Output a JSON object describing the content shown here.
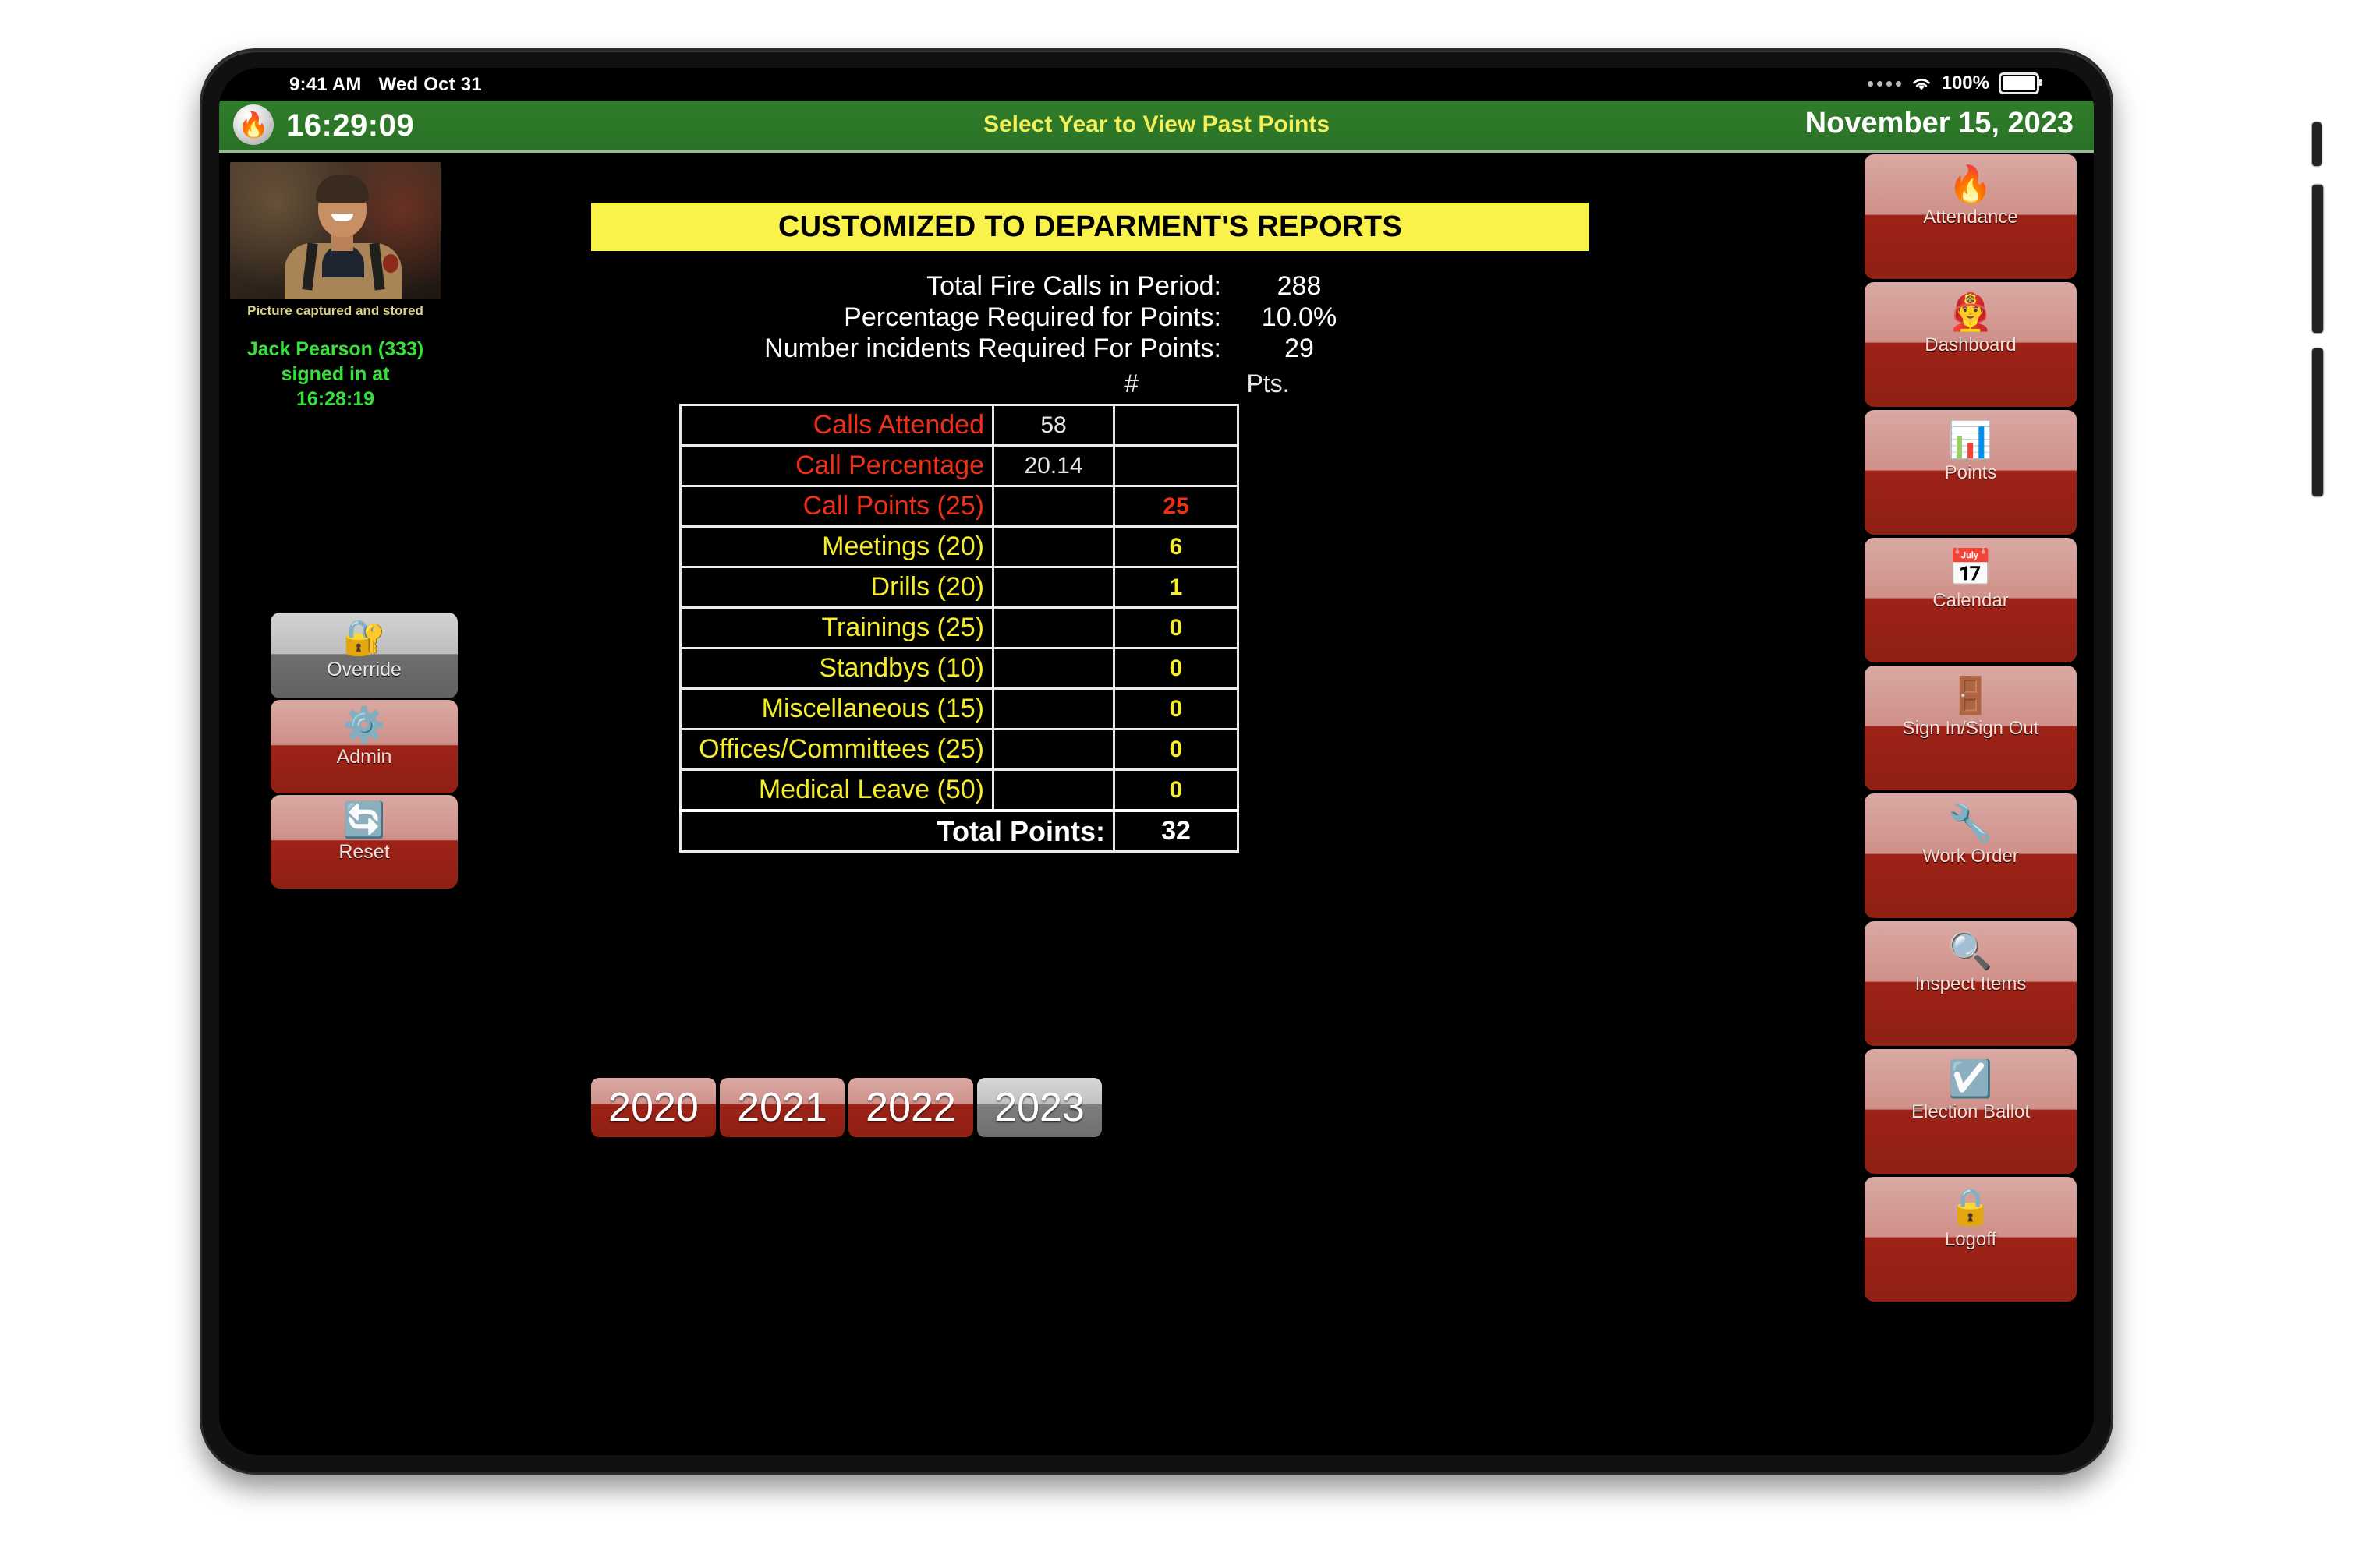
{
  "status_bar": {
    "time": "9:41 AM",
    "date": "Wed Oct 31",
    "battery_pct": "100%",
    "wifi_icon": "wifi-icon",
    "battery_icon": "battery-icon"
  },
  "app_bar": {
    "logo_icon": "flame-logo-icon",
    "clock": "16:29:09",
    "center_message": "Select Year to View Past Points",
    "date": "November 15, 2023"
  },
  "left_panel": {
    "photo_caption": "Picture captured and stored",
    "signed_in_line1": "Jack Pearson (333)",
    "signed_in_line2": "signed in at",
    "signed_in_line3": "16:28:19",
    "buttons": [
      {
        "label": "Override",
        "icon": "lock-key-icon",
        "selected": true
      },
      {
        "label": "Admin",
        "icon": "gear-icon",
        "selected": false
      },
      {
        "label": "Reset",
        "icon": "refresh-arrow-icon",
        "selected": false
      }
    ]
  },
  "right_panel": {
    "buttons": [
      {
        "label": "Attendance",
        "icon": "flame-icon"
      },
      {
        "label": "Dashboard",
        "icon": "firefighter-icon"
      },
      {
        "label": "Points",
        "icon": "report-document-icon"
      },
      {
        "label": "Calendar",
        "icon": "calendar-clock-icon"
      },
      {
        "label": "Sign In/Sign Out",
        "icon": "door-traffic-light-icon"
      },
      {
        "label": "Work Order",
        "icon": "wrench-document-icon"
      },
      {
        "label": "Inspect Items",
        "icon": "magnifier-icon"
      },
      {
        "label": "Election Ballot",
        "icon": "checkmark-box-icon"
      },
      {
        "label": "Logoff",
        "icon": "padlock-icon"
      }
    ]
  },
  "report": {
    "banner_title": "CUSTOMIZED TO DEPARMENT'S REPORTS",
    "summary": [
      {
        "label": "Total Fire Calls in Period:",
        "value": "288"
      },
      {
        "label": "Percentage Required for Points:",
        "value": "10.0%"
      },
      {
        "label": "Number incidents Required For Points:",
        "value": "29"
      }
    ],
    "columns": {
      "count": "#",
      "points": "Pts."
    },
    "rows": [
      {
        "label": "Calls Attended",
        "num": "58",
        "pts": "",
        "color": "red"
      },
      {
        "label": "Call Percentage",
        "num": "20.14",
        "pts": "",
        "color": "red"
      },
      {
        "label": "Call Points (25)",
        "num": "",
        "pts": "25",
        "color": "red"
      },
      {
        "label": "Meetings (20)",
        "num": "",
        "pts": "6",
        "color": "yel"
      },
      {
        "label": "Drills (20)",
        "num": "",
        "pts": "1",
        "color": "yel"
      },
      {
        "label": "Trainings (25)",
        "num": "",
        "pts": "0",
        "color": "yel"
      },
      {
        "label": "Standbys (10)",
        "num": "",
        "pts": "0",
        "color": "yel"
      },
      {
        "label": "Miscellaneous (15)",
        "num": "",
        "pts": "0",
        "color": "yel"
      },
      {
        "label": "Offices/Committees (25)",
        "num": "",
        "pts": "0",
        "color": "yel"
      },
      {
        "label": "Medical Leave (50)",
        "num": "",
        "pts": "0",
        "color": "yel"
      }
    ],
    "total_label": "Total Points:",
    "total_value": "32"
  },
  "year_selector": {
    "years": [
      {
        "label": "2020",
        "selected": false
      },
      {
        "label": "2021",
        "selected": false
      },
      {
        "label": "2022",
        "selected": false
      },
      {
        "label": "2023",
        "selected": true
      }
    ]
  },
  "colors": {
    "app_bar_green": "#2f7d2a",
    "banner_yellow": "#f9f24a",
    "accent_red": "#ef2f18",
    "accent_yellow": "#f5ed2a",
    "signed_in_green": "#3ae03a",
    "button_red": "#9e2217"
  }
}
